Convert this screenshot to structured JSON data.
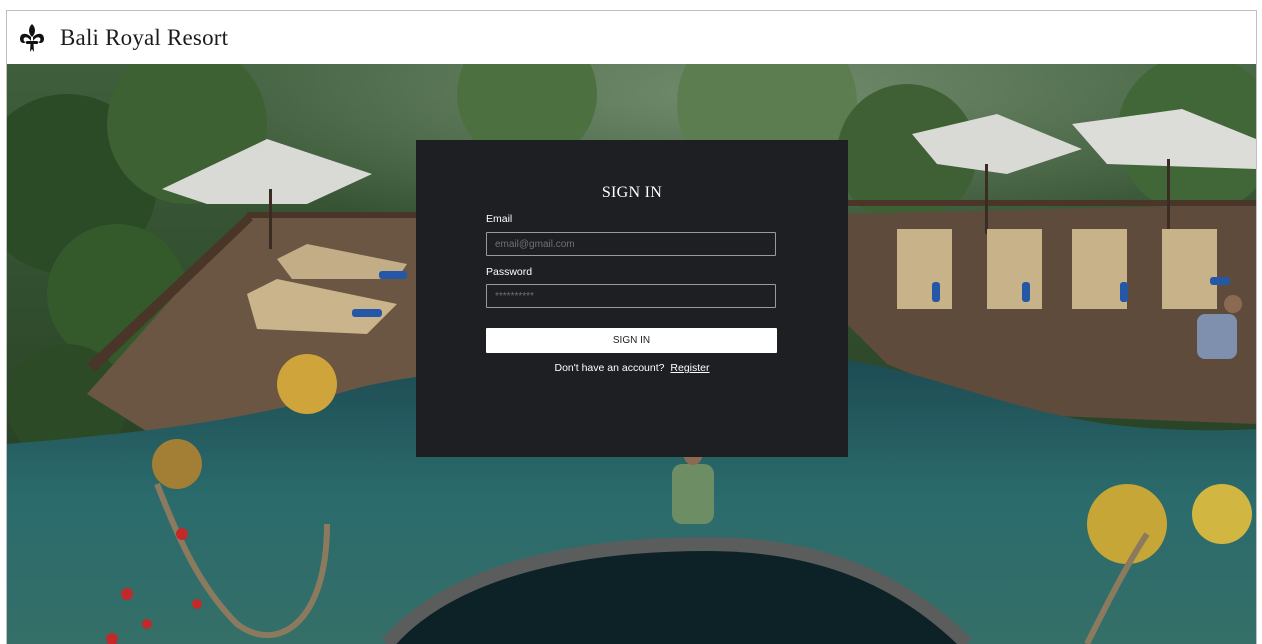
{
  "header": {
    "brand": "Bali Royal Resort",
    "logo_icon": "fleur-de-lis-icon"
  },
  "signin": {
    "title": "SIGN IN",
    "email_label": "Email",
    "email_placeholder": "email@gmail.com",
    "email_value": "",
    "password_label": "Password",
    "password_placeholder": "**********",
    "password_value": "",
    "button_label": "SIGN IN",
    "register_prompt": "Don't have an account?",
    "register_link": "Register"
  },
  "colors": {
    "panel_bg": "#1e1f22",
    "header_bg": "#ffffff",
    "button_bg": "#ffffff"
  }
}
